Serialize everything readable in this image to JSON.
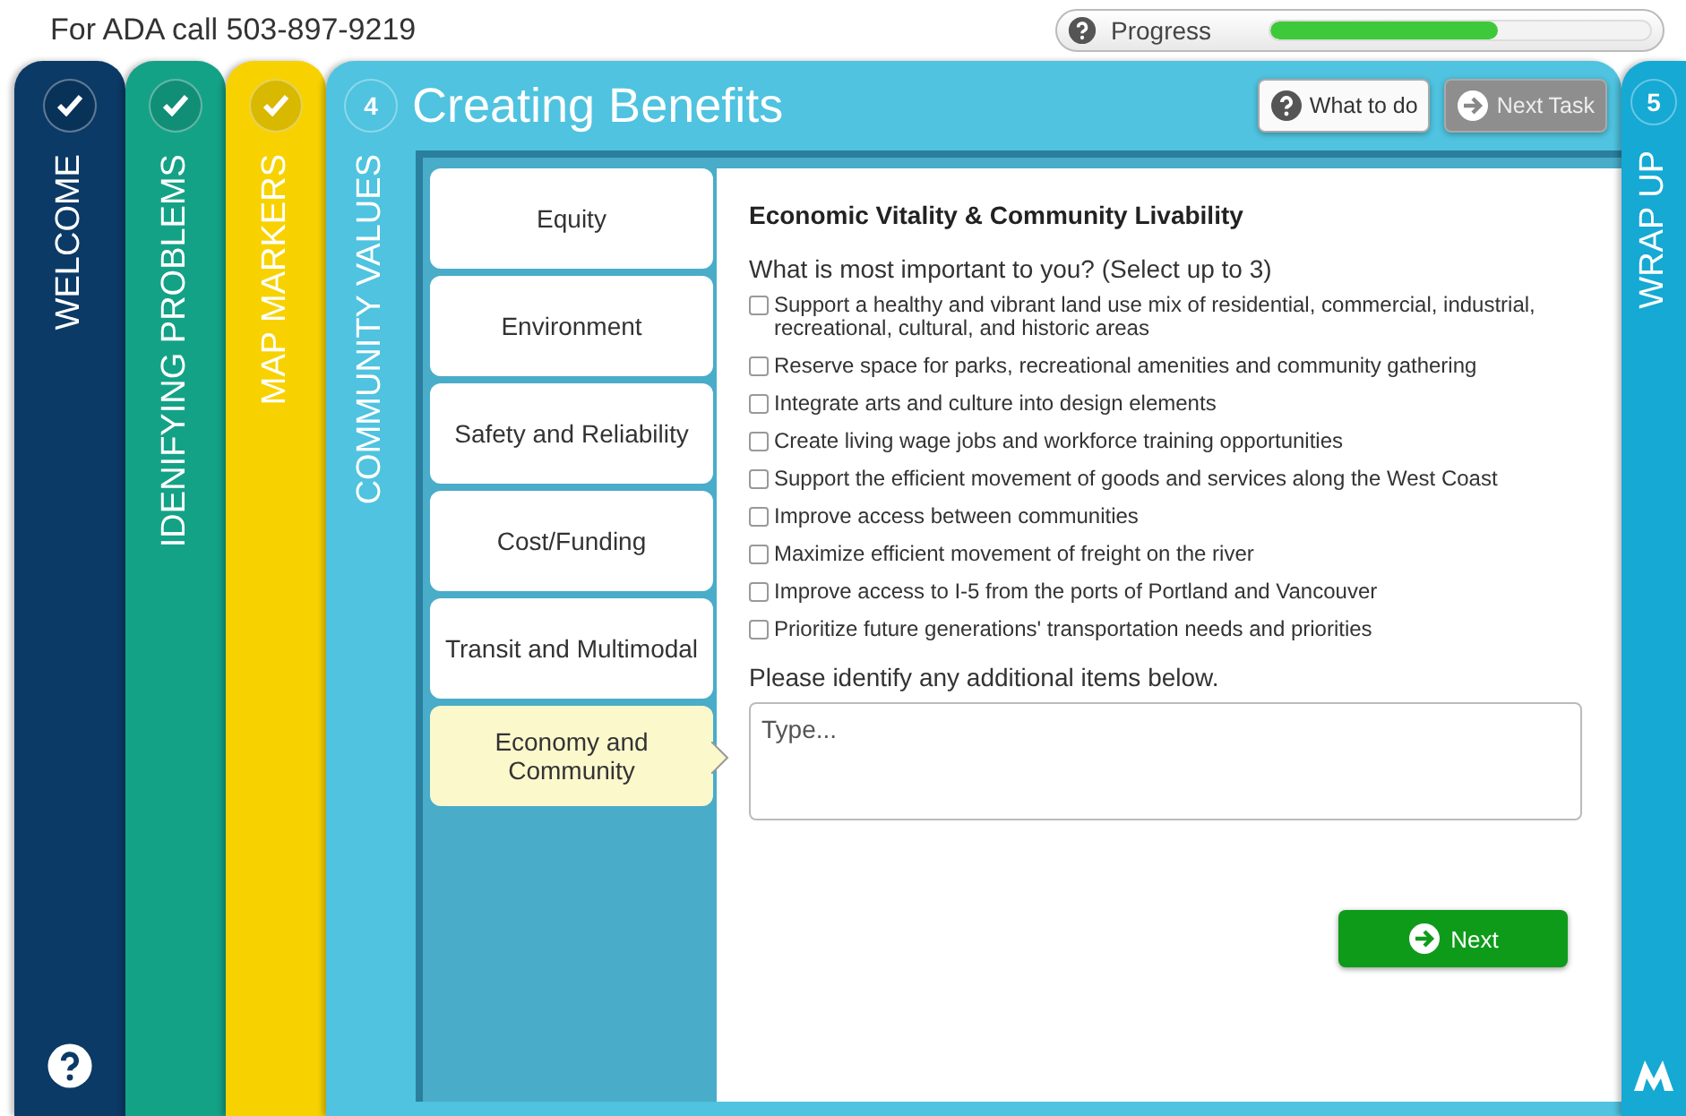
{
  "ada_notice": "For ADA call 503-897-9219",
  "progress": {
    "label": "Progress",
    "level": 0.6
  },
  "stages": [
    {
      "label": "WELCOME",
      "completed": true,
      "color": "#0b3a66"
    },
    {
      "label": "IDENIFYING PROBLEMS",
      "completed": true,
      "color": "#14a287"
    },
    {
      "label": "MAP MARKERS",
      "completed": true,
      "color": "#f7d200"
    }
  ],
  "current_stage": {
    "number": "4",
    "label": "COMMUNITY VALUES",
    "title": "Creating Benefits"
  },
  "next_stage": {
    "number": "5",
    "label": "WRAP UP"
  },
  "toolbar": {
    "help_button": "What to do",
    "next_task_button": {
      "label": "Next Task",
      "disabled": true
    }
  },
  "categories": [
    {
      "label": "Equity",
      "selected": false
    },
    {
      "label": "Environment",
      "selected": false
    },
    {
      "label": "Safety and Reliability",
      "selected": false
    },
    {
      "label": "Cost/Funding",
      "selected": false
    },
    {
      "label": "Transit and Multimodal",
      "selected": false
    },
    {
      "label": "Economy and Community",
      "selected": true
    }
  ],
  "content": {
    "heading": "Economic Vitality & Community Livability",
    "question": "What is most important to you? (Select up to 3)",
    "options": [
      {
        "label": "Support a healthy and vibrant land use mix of residential, commercial, industrial, recreational, cultural, and historic areas",
        "checked": false
      },
      {
        "label": "Reserve space for parks, recreational amenities and community gathering",
        "checked": false
      },
      {
        "label": "Integrate arts and culture into design elements",
        "checked": false
      },
      {
        "label": "Create living wage jobs and workforce training opportunities",
        "checked": false
      },
      {
        "label": "Support the efficient movement of goods and services along the West Coast",
        "checked": false
      },
      {
        "label": "Improve access between communities",
        "checked": false
      },
      {
        "label": "Maximize efficient movement of freight on the river",
        "checked": false
      },
      {
        "label": "Improve access to I-5 from the ports of Portland and Vancouver",
        "checked": false
      },
      {
        "label": "Prioritize future generations' transportation needs and priorities",
        "checked": false
      }
    ],
    "additional_prompt": "Please identify any additional items below.",
    "additional_field": {
      "placeholder": "Type..."
    },
    "next_button": "Next"
  }
}
